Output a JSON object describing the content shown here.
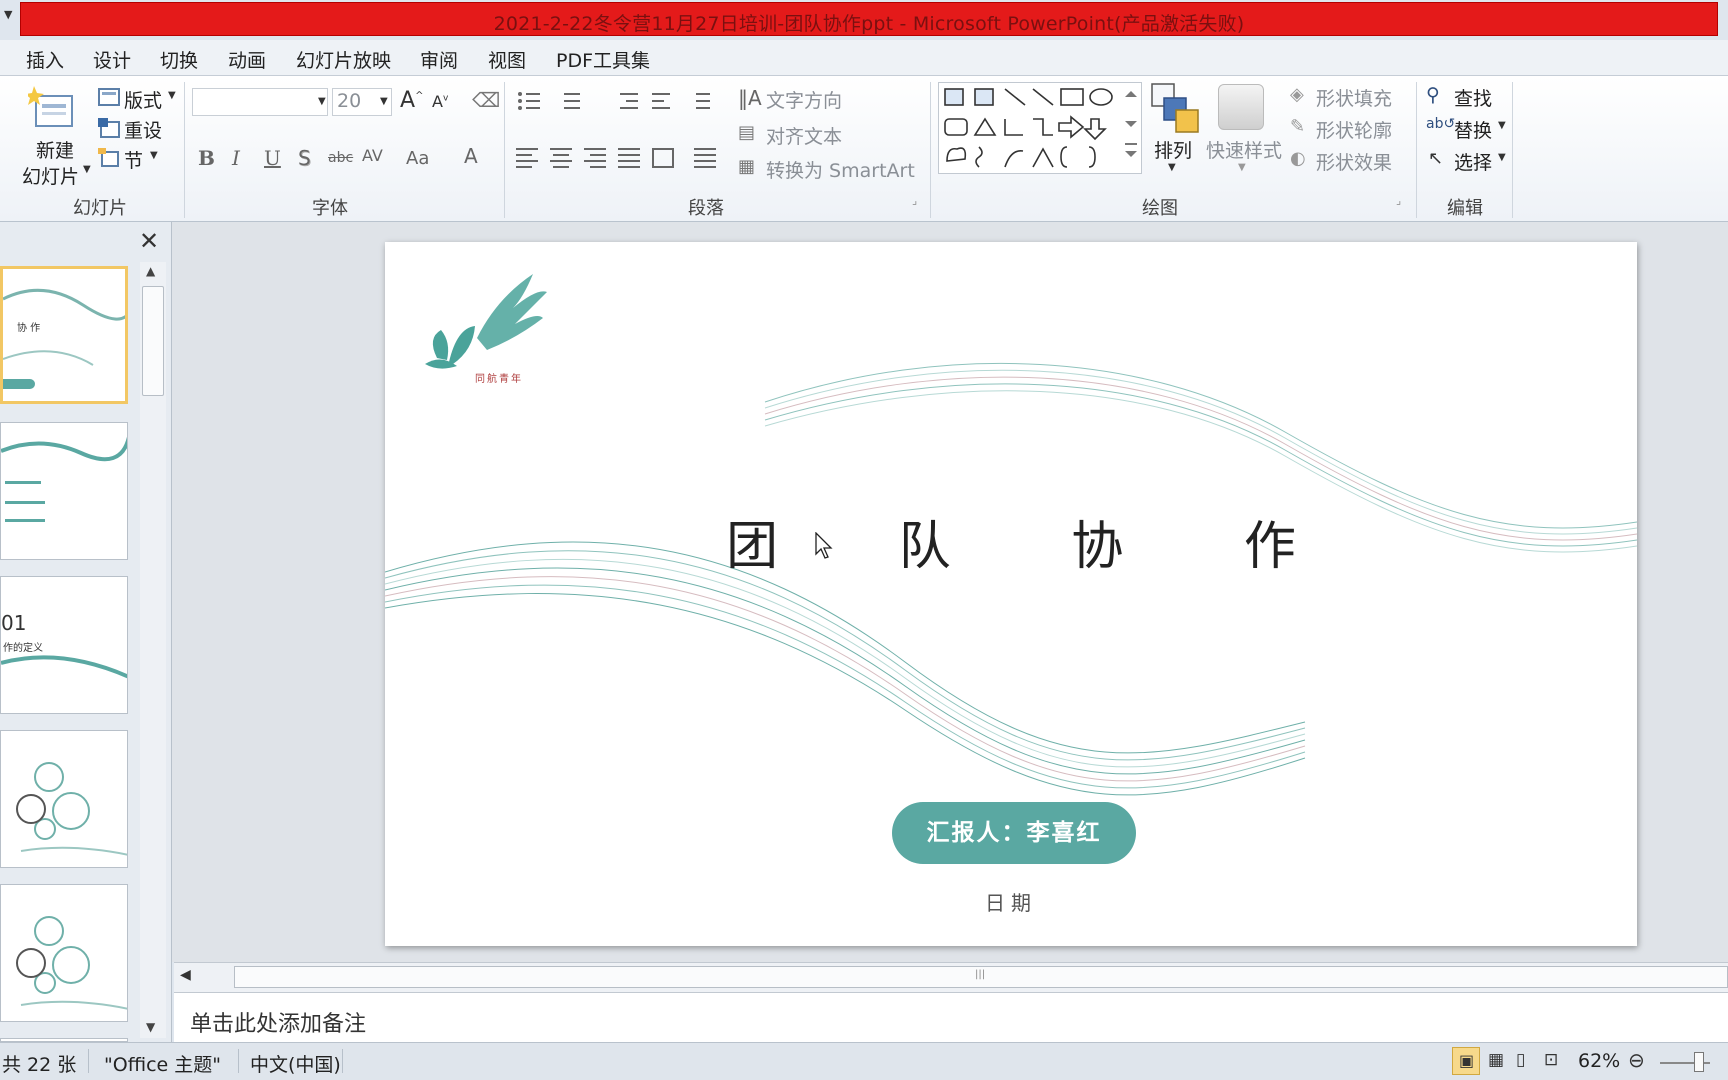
{
  "window": {
    "title": "2021-2-22冬令营11月27日培训-团队协作ppt - Microsoft PowerPoint(产品激活失败)"
  },
  "menu": {
    "tabs": [
      "插入",
      "设计",
      "切换",
      "动画",
      "幻灯片放映",
      "审阅",
      "视图",
      "PDF工具集"
    ]
  },
  "ribbon": {
    "slides": {
      "new_slide_1": "新建",
      "new_slide_2": "幻灯片",
      "layout": "版式",
      "reset": "重设",
      "section": "节",
      "label": "幻灯片"
    },
    "font": {
      "size": "20",
      "label": "字体"
    },
    "paragraph": {
      "text_direction": "文字方向",
      "align_text": "对齐文本",
      "convert_smartart": "转换为 SmartArt",
      "label": "段落"
    },
    "drawing": {
      "arrange": "排列",
      "quick_styles": "快速样式",
      "shape_fill": "形状填充",
      "shape_outline": "形状轮廓",
      "shape_effects": "形状效果",
      "label": "绘图"
    },
    "editing": {
      "find": "查找",
      "replace": "替换",
      "select": "选择",
      "label": "编辑"
    }
  },
  "thumbnails": {
    "t1_title": "协 作",
    "t3_number": "01",
    "t3_text": "作的定义"
  },
  "slide": {
    "title_chars": [
      "团",
      "队",
      "协",
      "作"
    ],
    "logo_caption": "同航青年",
    "reporter": "汇报人：李喜红",
    "date": "日期"
  },
  "notes": {
    "placeholder": "单击此处添加备注"
  },
  "status": {
    "slide_count": "共 22 张",
    "theme": "\"Office 主题\"",
    "language": "中文(中国)",
    "zoom": "62%"
  },
  "colors": {
    "accent_teal": "#5aa8a2",
    "title_bar_red": "#e41a1a",
    "selected_thumb_border": "#f2c764"
  }
}
